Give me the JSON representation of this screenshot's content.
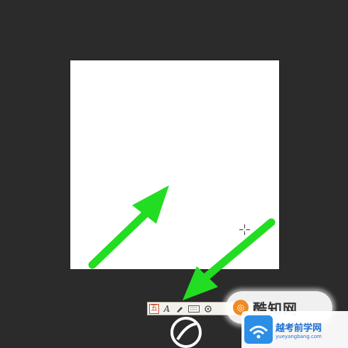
{
  "colors": {
    "workspace_bg": "#2b2b2b",
    "document_bg": "#ffffff",
    "annotation_arrow": "#22dd22",
    "watermark_accent": "#f08a24",
    "site_blue": "#1e6fd0"
  },
  "icons": {
    "cursor": "crosshair-cursor-icon",
    "arrow_primary": "green-arrow-up-right-icon",
    "arrow_secondary": "green-arrow-down-left-icon"
  },
  "ime_toolbar": {
    "logo_glyph": "五",
    "mode_glyph": "A",
    "tools": [
      "pen-icon",
      "keyboard-icon",
      "settings-icon"
    ]
  },
  "watermark": {
    "text": "酷知网"
  },
  "site_badge": {
    "name": "越考前学网",
    "url": "yueyangbang.com"
  }
}
